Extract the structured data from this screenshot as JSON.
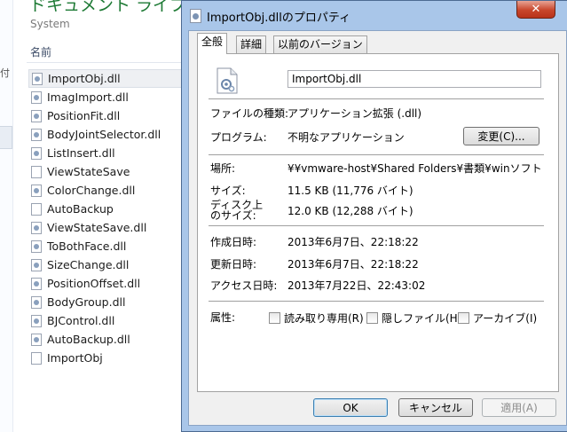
{
  "explorer": {
    "title": "ドキュメント ライブ",
    "subtitle": "System",
    "left_mark": "付",
    "column_header": "名前",
    "files": [
      {
        "name": "ImportObj.dll",
        "type": "dll",
        "selected": true
      },
      {
        "name": "ImagImport.dll",
        "type": "dll"
      },
      {
        "name": "PositionFit.dll",
        "type": "dll"
      },
      {
        "name": "BodyJointSelector.dll",
        "type": "dll"
      },
      {
        "name": "ListInsert.dll",
        "type": "dll"
      },
      {
        "name": "ViewStateSave",
        "type": "file"
      },
      {
        "name": "ColorChange.dll",
        "type": "dll"
      },
      {
        "name": "AutoBackup",
        "type": "file"
      },
      {
        "name": "ViewStateSave.dll",
        "type": "dll"
      },
      {
        "name": "ToBothFace.dll",
        "type": "dll"
      },
      {
        "name": "SizeChange.dll",
        "type": "dll"
      },
      {
        "name": "PositionOffset.dll",
        "type": "dll"
      },
      {
        "name": "BodyGroup.dll",
        "type": "dll"
      },
      {
        "name": "BJControl.dll",
        "type": "dll"
      },
      {
        "name": "AutoBackup.dll",
        "type": "dll"
      },
      {
        "name": "ImportObj",
        "type": "file"
      }
    ]
  },
  "dialog": {
    "title": "ImportObj.dllのプロパティ",
    "close_glyph": "✕",
    "tabs": [
      "全般",
      "詳細",
      "以前のバージョン"
    ],
    "active_tab": 0,
    "file_name": "ImportObj.dll",
    "file_type_label": "ファイルの種類:",
    "file_type_value": "アプリケーション拡張 (.dll)",
    "program_label": "プログラム:",
    "program_value": "不明なアプリケーション",
    "change_button": "変更(C)...",
    "location_label": "場所:",
    "location_value": "¥¥vmware-host¥Shared Folders¥書類¥winソフト¥PmxEdit",
    "size_label": "サイズ:",
    "size_value": "11.5 KB (11,776 バイト)",
    "disk_size_label_line1": "ディスク上",
    "disk_size_label_line2": "のサイズ:",
    "disk_size_value": "12.0 KB (12,288 バイト)",
    "created_label": "作成日時:",
    "created_value": "2013年6月7日、22:18:22",
    "modified_label": "更新日時:",
    "modified_value": "2013年6月7日、22:18:22",
    "accessed_label": "アクセス日時:",
    "accessed_value": "2013年7月22日、22:43:02",
    "attributes_label": "属性:",
    "attr_readonly": "読み取り専用(R)",
    "attr_hidden": "隠しファイル(H)",
    "attr_archive": "アーカイブ(I)",
    "ok_button": "OK",
    "cancel_button": "キャンセル",
    "apply_button": "適用(A)"
  }
}
